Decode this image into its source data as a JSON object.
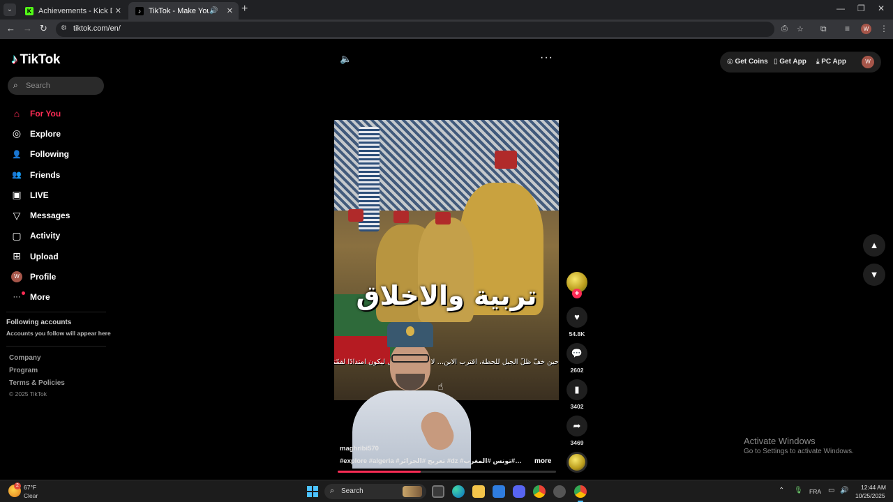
{
  "browser": {
    "tabs": [
      {
        "title": "Achievements - Kick Dashboard",
        "favicon": "K",
        "active": false
      },
      {
        "title": "TikTok - Make Your Day",
        "favicon": "♪",
        "active": true
      }
    ],
    "url": "tiktok.com/en/",
    "profile_initial": "W"
  },
  "tiktok": {
    "logo_text": "TikTok",
    "search_placeholder": "Search",
    "nav": [
      {
        "label": "For You",
        "icon": "home-icon",
        "glyph": "⌂",
        "selected": true
      },
      {
        "label": "Explore",
        "icon": "compass-icon",
        "glyph": "◎"
      },
      {
        "label": "Following",
        "icon": "user-follow-icon",
        "glyph": "👤"
      },
      {
        "label": "Friends",
        "icon": "friends-icon",
        "glyph": "👥"
      },
      {
        "label": "LIVE",
        "icon": "live-icon",
        "glyph": "▣"
      },
      {
        "label": "Messages",
        "icon": "send-icon",
        "glyph": "▽"
      },
      {
        "label": "Activity",
        "icon": "activity-icon",
        "glyph": "▢"
      },
      {
        "label": "Upload",
        "icon": "upload-icon",
        "glyph": "⊞"
      },
      {
        "label": "Profile",
        "icon": "avatar",
        "glyph": "W"
      },
      {
        "label": "More",
        "icon": "more-icon",
        "glyph": "···"
      }
    ],
    "following_accounts": {
      "title": "Following accounts",
      "subtitle": "Accounts you follow will appear here"
    },
    "footer": {
      "links": [
        "Company",
        "Program",
        "Terms & Policies"
      ],
      "copyright": "© 2025 TikTok"
    },
    "top_right": {
      "get_coins": "Get Coins",
      "get_app": "Get App",
      "pc_app": "PC App",
      "avatar_initial": "W"
    },
    "video": {
      "caption_overlay": "تربية والاخلاق",
      "subtitle_overlay": "حين خفَّ ظلّ الجبل للحظة، اقترب الابن... لا ليأخذ مكانه بل ليكون امتدادًا لقمّته",
      "author": "maghribi570",
      "hashtags": "#explore #algeria #تعريج #الجزائر #dz #الجزائر #تونس #المغرب #dz ...",
      "more_label": "more",
      "progress_fraction": 0.38
    },
    "actions": {
      "likes": "54.8K",
      "comments": "2602",
      "saves": "3402",
      "shares": "3469"
    },
    "accent_color": "#fe2c55"
  },
  "windows_overlay": {
    "activate_title": "Activate Windows",
    "activate_sub": "Go to Settings to activate Windows."
  },
  "taskbar": {
    "temperature": "67°F",
    "condition": "Clear",
    "weather_badge": "2",
    "search_label": "Search",
    "language": "FRA",
    "time": "12:44 AM",
    "date": "10/25/2025"
  }
}
